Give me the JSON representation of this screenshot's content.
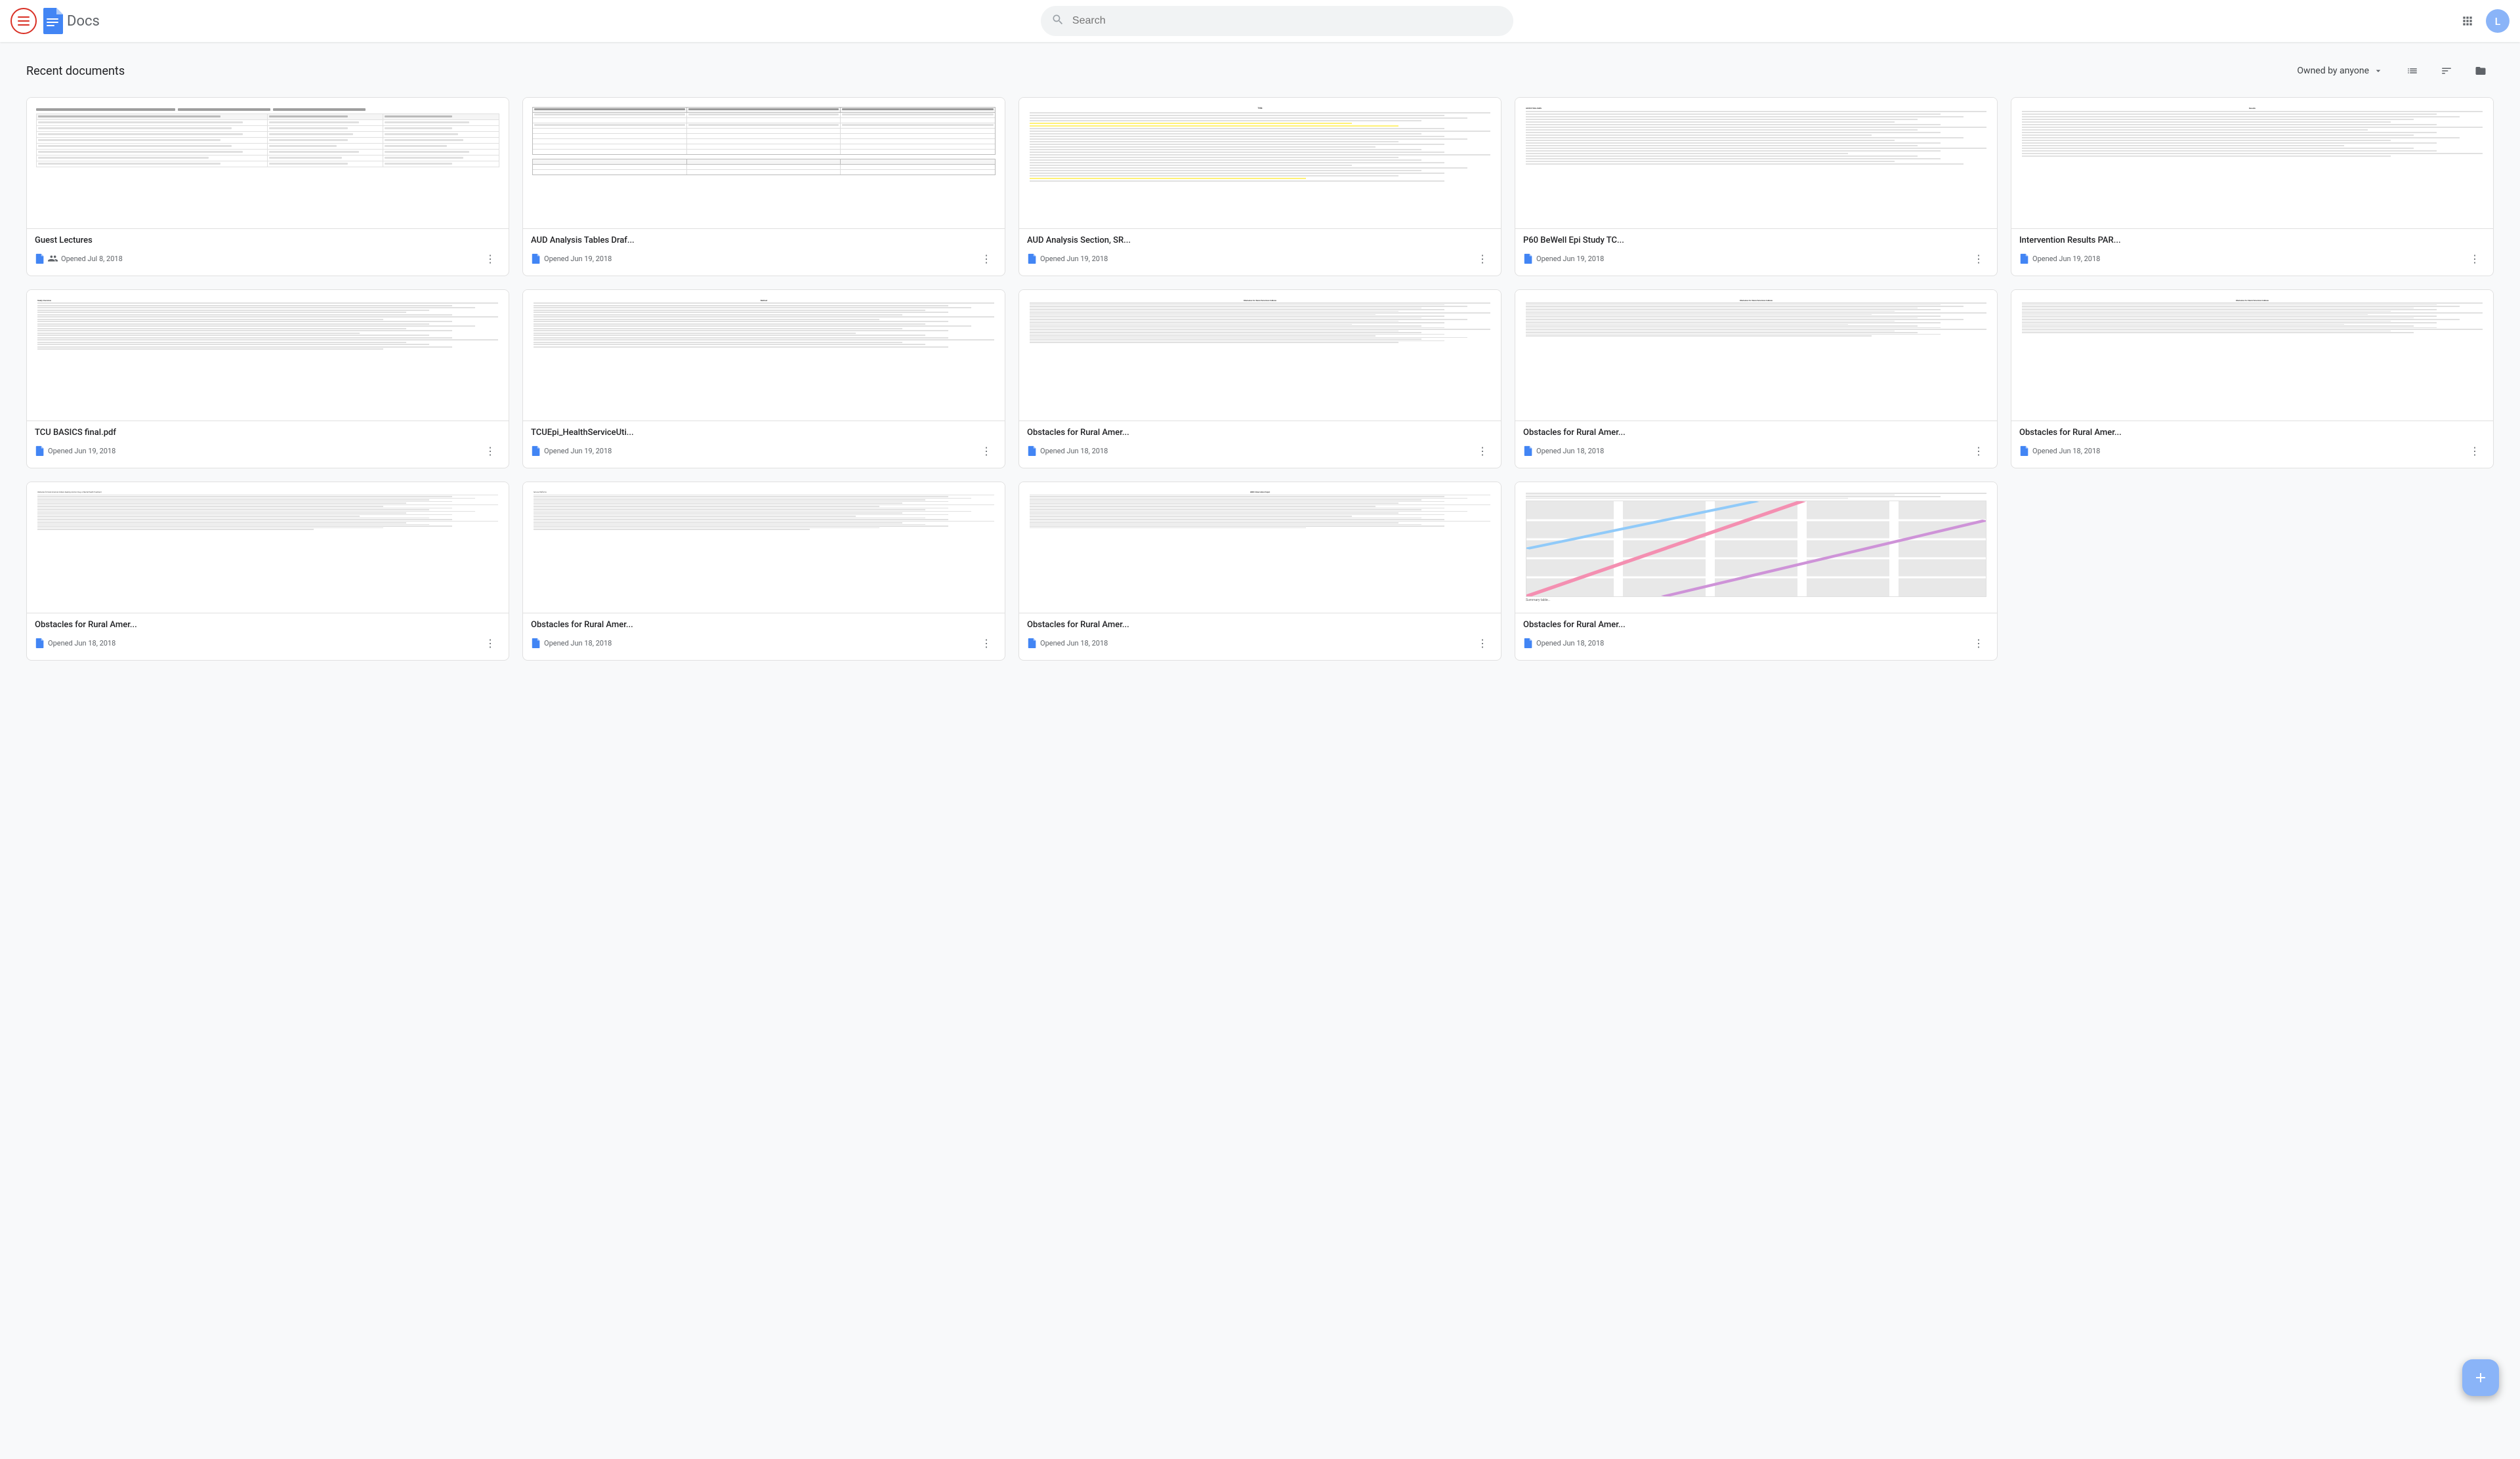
{
  "header": {
    "menu_label": "Main menu",
    "logo_text": "Docs",
    "search_placeholder": "Search",
    "search_value": "",
    "grid_icon": "apps",
    "avatar_initials": "L",
    "avatar_color": "#8ab4f8"
  },
  "toolbar": {
    "title": "Recent documents",
    "owner_filter": "Owned by anyone",
    "view_list_label": "List view",
    "view_sort_label": "Sort options",
    "view_folder_label": "Folder view"
  },
  "documents": [
    {
      "id": 1,
      "title": "Guest Lectures",
      "date": "Opened Jul 8, 2018",
      "shared": true,
      "preview_type": "table",
      "has_people_icon": true
    },
    {
      "id": 2,
      "title": "AUD Analysis Tables Draf...",
      "date": "Opened Jun 19, 2018",
      "shared": false,
      "preview_type": "table2"
    },
    {
      "id": 3,
      "title": "AUD Analysis Section, SR...",
      "date": "Opened Jun 19, 2018",
      "shared": false,
      "preview_type": "text_highlight"
    },
    {
      "id": 4,
      "title": "P60 BeWell Epi Study TC...",
      "date": "Opened Jun 19, 2018",
      "shared": false,
      "preview_type": "text"
    },
    {
      "id": 5,
      "title": "Intervention Results PAR...",
      "date": "Opened Jun 19, 2018",
      "shared": false,
      "preview_type": "text"
    },
    {
      "id": 6,
      "title": "TCU BASICS final.pdf",
      "date": "Opened Jun 19, 2018",
      "shared": false,
      "preview_type": "text_dense"
    },
    {
      "id": 7,
      "title": "TCUEpi_HealthServiceUti...",
      "date": "Opened Jun 19, 2018",
      "shared": false,
      "preview_type": "text_method"
    },
    {
      "id": 8,
      "title": "Obstacles for Rural Amer...",
      "date": "Opened Jun 18, 2018",
      "shared": false,
      "preview_type": "text_obstacles"
    },
    {
      "id": 9,
      "title": "Obstacles for Rural Amer...",
      "date": "Opened Jun 18, 2018",
      "shared": false,
      "preview_type": "text_obstacles"
    },
    {
      "id": 10,
      "title": "Obstacles for Rural Amer...",
      "date": "Opened Jun 18, 2018",
      "shared": false,
      "preview_type": "text_obstacles"
    },
    {
      "id": 11,
      "title": "Obstacles for Rural Amer...",
      "date": "Opened Jun 18, 2018",
      "shared": false,
      "preview_type": "text_obstacles2"
    },
    {
      "id": 12,
      "title": "Obstacles for Rural Amer...",
      "date": "Opened Jun 18, 2018",
      "shared": false,
      "preview_type": "text_obstacles2"
    },
    {
      "id": 13,
      "title": "",
      "date": "Opened Jun 18, 2018",
      "shared": false,
      "preview_type": "text_obstacles2"
    },
    {
      "id": 14,
      "title": "",
      "date": "Opened Jun 18, 2018",
      "shared": false,
      "preview_type": "map"
    }
  ],
  "fab": {
    "label": "+"
  }
}
